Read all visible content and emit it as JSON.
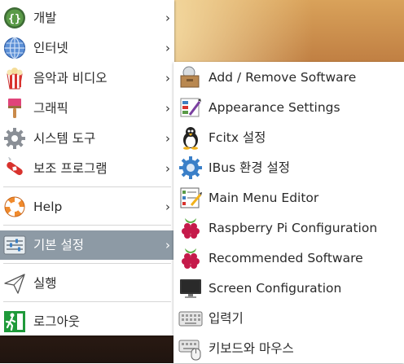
{
  "main_menu": {
    "items": [
      {
        "label": "개발",
        "icon": "code-braces-icon",
        "has_submenu": true
      },
      {
        "label": "인터넷",
        "icon": "globe-icon",
        "has_submenu": true
      },
      {
        "label": "음악과 비디오",
        "icon": "popcorn-icon",
        "has_submenu": true
      },
      {
        "label": "그래픽",
        "icon": "paintbrush-icon",
        "has_submenu": true
      },
      {
        "label": "시스템 도구",
        "icon": "gear-icon",
        "has_submenu": true
      },
      {
        "label": "보조 프로그램",
        "icon": "swiss-knife-icon",
        "has_submenu": true
      },
      {
        "label": "Help",
        "icon": "lifebuoy-icon",
        "has_submenu": true
      },
      {
        "label": "기본 설정",
        "icon": "settings-sliders-icon",
        "has_submenu": true,
        "active": true
      },
      {
        "label": "실행",
        "icon": "paper-plane-icon",
        "has_submenu": false
      },
      {
        "label": "로그아웃",
        "icon": "exit-running-man-icon",
        "has_submenu": false
      }
    ],
    "arrow": "›"
  },
  "submenu": {
    "items": [
      {
        "label": "Add / Remove Software",
        "icon": "package-box-icon"
      },
      {
        "label": "Appearance Settings",
        "icon": "color-swatches-icon"
      },
      {
        "label": "Fcitx 설정",
        "icon": "penguin-icon"
      },
      {
        "label": "IBus 환경 설정",
        "icon": "blue-gear-icon"
      },
      {
        "label": "Main Menu Editor",
        "icon": "menu-editor-icon"
      },
      {
        "label": "Raspberry Pi Configuration",
        "icon": "raspberry-icon"
      },
      {
        "label": "Recommended Software",
        "icon": "raspberry-icon"
      },
      {
        "label": "Screen Configuration",
        "icon": "monitor-icon"
      },
      {
        "label": "입력기",
        "icon": "keyboard-icon"
      },
      {
        "label": "키보드와 마우스",
        "icon": "keyboard-mouse-icon"
      }
    ]
  },
  "colors": {
    "menu_bg": "#ffffff",
    "active_bg": "#8d9aa5",
    "text": "#2a2a2a"
  }
}
